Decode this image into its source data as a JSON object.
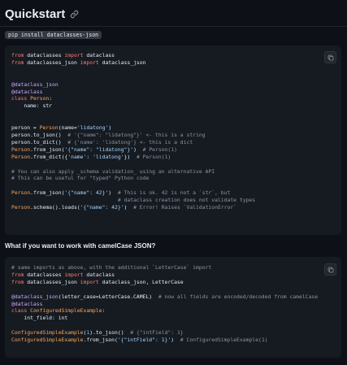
{
  "title": "Quickstart",
  "install_command": "pip install dataclasses-json",
  "subheading": "What if you want to work with camelCase JSON?",
  "icons": {
    "anchor": "link-icon",
    "copy": "copy-icon"
  },
  "colors": {
    "background": "#0d1117",
    "code_background": "#161b22",
    "keyword": "#ff7b72",
    "decorator": "#d2a8ff",
    "class_name": "#ffa657",
    "string": "#a5d6ff",
    "number": "#79c0ff",
    "comment": "#8b949e"
  },
  "code_block_1": {
    "lines": [
      [
        {
          "t": "from",
          "c": "kw"
        },
        {
          "t": " dataclasses ",
          "c": ""
        },
        {
          "t": "import",
          "c": "kw"
        },
        {
          "t": " dataclass",
          "c": ""
        }
      ],
      [
        {
          "t": "from",
          "c": "kw"
        },
        {
          "t": " dataclasses_json ",
          "c": ""
        },
        {
          "t": "import",
          "c": "kw"
        },
        {
          "t": " dataclass_json",
          "c": ""
        }
      ],
      [],
      [],
      [
        {
          "t": "@dataclass_json",
          "c": "deco"
        }
      ],
      [
        {
          "t": "@dataclass",
          "c": "deco"
        }
      ],
      [
        {
          "t": "class",
          "c": "kw"
        },
        {
          "t": " ",
          "c": ""
        },
        {
          "t": "Person",
          "c": "cls"
        },
        {
          "t": ":",
          "c": ""
        }
      ],
      [
        {
          "t": "    name: str",
          "c": ""
        }
      ],
      [],
      [],
      [
        {
          "t": "person = ",
          "c": ""
        },
        {
          "t": "Person",
          "c": "cls"
        },
        {
          "t": "(name=",
          "c": ""
        },
        {
          "t": "'lidatong'",
          "c": "str"
        },
        {
          "t": ")",
          "c": ""
        }
      ],
      [
        {
          "t": "person.to_json()  ",
          "c": ""
        },
        {
          "t": "# '{\"name\": \"lidatong\"}' <- this is a string",
          "c": "cm"
        }
      ],
      [
        {
          "t": "person.to_dict()  ",
          "c": ""
        },
        {
          "t": "# {'name': 'lidatong'} <- this is a dict",
          "c": "cm"
        }
      ],
      [
        {
          "t": "Person",
          "c": "cls"
        },
        {
          "t": ".from_json(",
          "c": ""
        },
        {
          "t": "'{\"name\": \"lidatong\"}'",
          "c": "str"
        },
        {
          "t": ")  ",
          "c": ""
        },
        {
          "t": "# Person(1)",
          "c": "cm"
        }
      ],
      [
        {
          "t": "Person",
          "c": "cls"
        },
        {
          "t": ".from_dict({",
          "c": ""
        },
        {
          "t": "'name'",
          "c": "str"
        },
        {
          "t": ": ",
          "c": ""
        },
        {
          "t": "'lidatong'",
          "c": "str"
        },
        {
          "t": "})  ",
          "c": ""
        },
        {
          "t": "# Person(1)",
          "c": "cm"
        }
      ],
      [],
      [
        {
          "t": "# You can also apply _schema validation_ using an alternative API",
          "c": "cm"
        }
      ],
      [
        {
          "t": "# This can be useful for \"typed\" Python code",
          "c": "cm"
        }
      ],
      [],
      [
        {
          "t": "Person",
          "c": "cls"
        },
        {
          "t": ".from_json(",
          "c": ""
        },
        {
          "t": "'{\"name\": 42}'",
          "c": "str"
        },
        {
          "t": ")  ",
          "c": ""
        },
        {
          "t": "# This is ok. 42 is not a `str`, but",
          "c": "cm"
        }
      ],
      [
        {
          "t": "                                  ",
          "c": ""
        },
        {
          "t": "# dataclass creation does not validate types",
          "c": "cm"
        }
      ],
      [
        {
          "t": "Person",
          "c": "cls"
        },
        {
          "t": ".schema().loads(",
          "c": ""
        },
        {
          "t": "'{\"name\": 42}'",
          "c": "str"
        },
        {
          "t": ")  ",
          "c": ""
        },
        {
          "t": "# Error! Raises `ValidationError`",
          "c": "cm"
        }
      ]
    ]
  },
  "code_block_2": {
    "lines": [
      [
        {
          "t": "# same imports as above, with the additional `LetterCase` import",
          "c": "cm"
        }
      ],
      [
        {
          "t": "from",
          "c": "kw"
        },
        {
          "t": " dataclasses ",
          "c": ""
        },
        {
          "t": "import",
          "c": "kw"
        },
        {
          "t": " dataclass",
          "c": ""
        }
      ],
      [
        {
          "t": "from",
          "c": "kw"
        },
        {
          "t": " dataclasses_json ",
          "c": ""
        },
        {
          "t": "import",
          "c": "kw"
        },
        {
          "t": " dataclass_json, LetterCase",
          "c": ""
        }
      ],
      [],
      [
        {
          "t": "@dataclass_json",
          "c": "deco"
        },
        {
          "t": "(letter_case=LetterCase.CAMEL)  ",
          "c": ""
        },
        {
          "t": "# now all fields are encoded/decoded from camelCase",
          "c": "cm"
        }
      ],
      [
        {
          "t": "@dataclass",
          "c": "deco"
        }
      ],
      [
        {
          "t": "class",
          "c": "kw"
        },
        {
          "t": " ",
          "c": ""
        },
        {
          "t": "ConfiguredSimpleExample",
          "c": "cls"
        },
        {
          "t": ":",
          "c": ""
        }
      ],
      [
        {
          "t": "    int_field: int",
          "c": ""
        }
      ],
      [],
      [
        {
          "t": "ConfiguredSimpleExample",
          "c": "cls"
        },
        {
          "t": "(",
          "c": ""
        },
        {
          "t": "1",
          "c": "num"
        },
        {
          "t": ").to_json()  ",
          "c": ""
        },
        {
          "t": "# {\"intField\": 1}",
          "c": "cm"
        }
      ],
      [
        {
          "t": "ConfiguredSimpleExample",
          "c": "cls"
        },
        {
          "t": ".from_json(",
          "c": ""
        },
        {
          "t": "'{\"intField\": 1}'",
          "c": "str"
        },
        {
          "t": ")  ",
          "c": ""
        },
        {
          "t": "# ConfiguredSimpleExample(1)",
          "c": "cm"
        }
      ]
    ]
  }
}
